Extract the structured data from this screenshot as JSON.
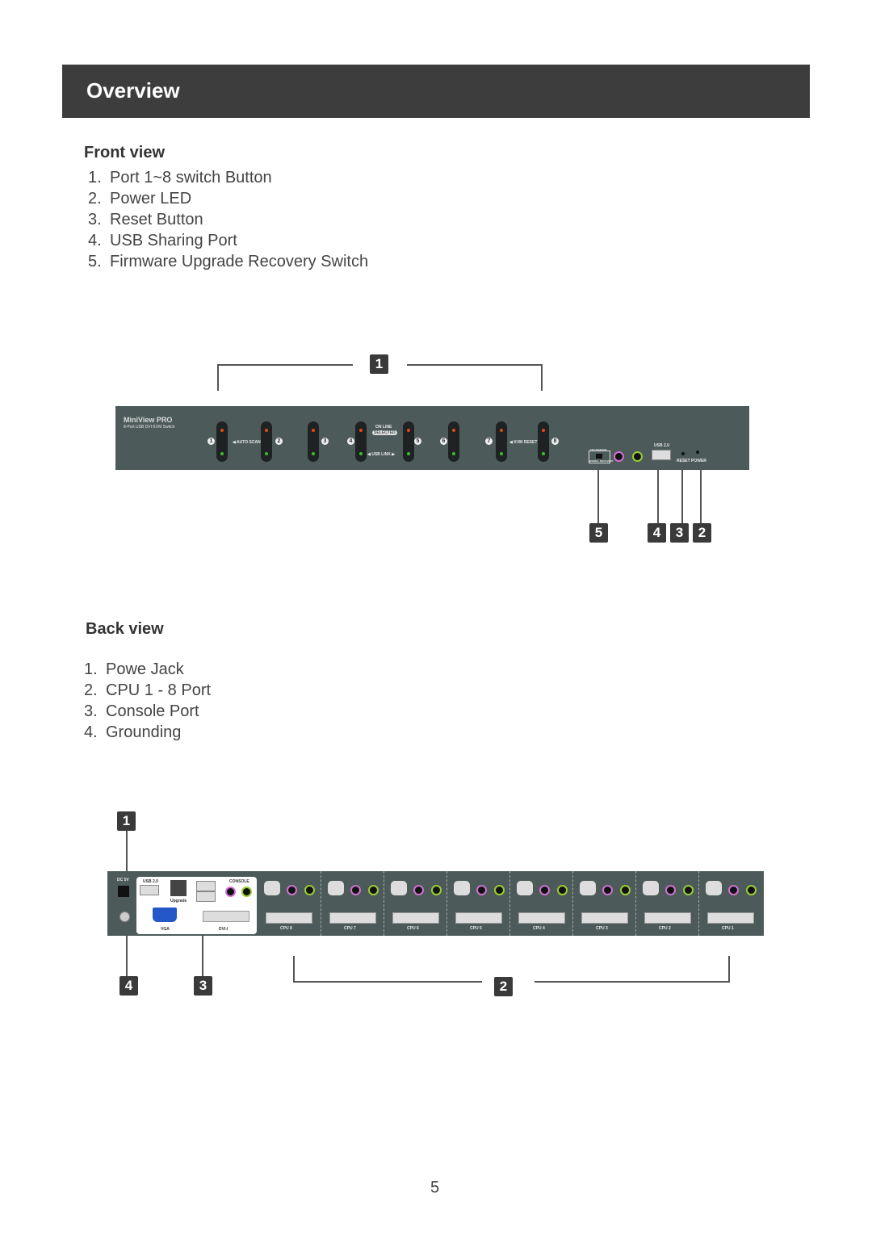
{
  "header": {
    "title": "Overview"
  },
  "front": {
    "title": "Front view",
    "items": [
      {
        "n": "1.",
        "label": "Port 1~8 switch Button"
      },
      {
        "n": "2.",
        "label": "Power LED"
      },
      {
        "n": "3.",
        "label": "Reset Button"
      },
      {
        "n": "4.",
        "label": "USB Sharing Port"
      },
      {
        "n": "5.",
        "label": "Firmware Upgrade Recovery Switch"
      }
    ],
    "callouts": [
      "1",
      "5",
      "4",
      "3",
      "2"
    ],
    "panel": {
      "brand": "MiniView PRO",
      "subtitle": "8-Port USB DVI KVM Switch",
      "ports": [
        "1",
        "2",
        "3",
        "4",
        "5",
        "6",
        "7",
        "8"
      ],
      "auto_scan": "◀ AUTO SCAN ▶",
      "on_line": "ON LINE",
      "selected": "SELECTED",
      "usb_link": "◀ USB LINK ▶",
      "kvm_reset": "◀ KVM RESET ▶",
      "fw_upgrade": "FW UPGRADE",
      "normal": "NORMAL RECOVERY",
      "usb2": "USB 2.0",
      "reset": "RESET",
      "power": "POWER",
      "led_red": "#e04a10",
      "led_green": "#3bbf2a"
    }
  },
  "back": {
    "title": "Back view",
    "items": [
      {
        "n": "1.",
        "label": "Powe Jack"
      },
      {
        "n": "2.",
        "label": "CPU 1 - 8 Port"
      },
      {
        "n": "3.",
        "label": "Console Port"
      },
      {
        "n": "4.",
        "label": "Grounding"
      }
    ],
    "callouts": [
      "1",
      "4",
      "3",
      "2"
    ],
    "panel": {
      "dc": "DC 5V",
      "usb2": "USB 2.0",
      "upgrade": "Upgrade",
      "console": "CONSOLE",
      "vga": "VGA",
      "dvi": "DVI-I",
      "cpus": [
        "CPU 8",
        "CPU 7",
        "CPU 6",
        "CPU 5",
        "CPU 4",
        "CPU 3",
        "CPU 2",
        "CPU 1"
      ],
      "mic_color": "#d070d0",
      "spk_color": "#9acd32"
    }
  },
  "page_number": "5"
}
